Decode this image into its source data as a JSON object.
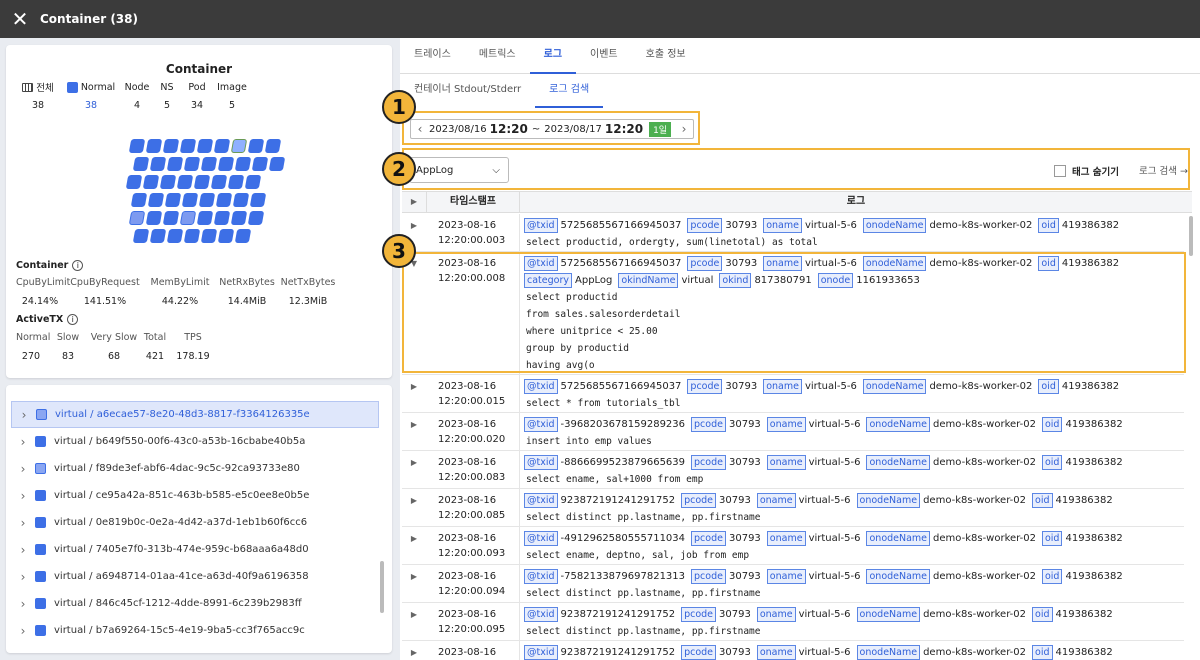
{
  "header": {
    "title": "Container (38)"
  },
  "summary": {
    "total_label": "전체",
    "total_value": "38",
    "normal_label": "Normal",
    "normal_value": "38",
    "node_label": "Node",
    "node_value": "4",
    "ns_label": "NS",
    "ns_value": "5",
    "pod_label": "Pod",
    "pod_value": "34",
    "image_label": "Image",
    "image_value": "5"
  },
  "panel_title": "Container",
  "container_metrics": {
    "title": "Container",
    "labels": [
      "CpuByLimit",
      "CpuByRequest",
      "MemByLimit",
      "NetRxBytes",
      "NetTxBytes"
    ],
    "values": [
      "24.14%",
      "141.51%",
      "44.22%",
      "14.4MiB",
      "12.3MiB"
    ]
  },
  "activetx": {
    "title": "ActiveTX",
    "labels": [
      "Normal",
      "Slow",
      "Very Slow",
      "Total",
      "TPS"
    ],
    "values": [
      "270",
      "83",
      "68",
      "421",
      "178.19"
    ]
  },
  "containers": [
    "virtual / a6ecae57-8e20-48d3-8817-f3364126335e",
    "virtual / b649f550-00f6-43c0-a53b-16cbabe40b5a",
    "virtual / f89de3ef-abf6-4dac-9c5c-92ca93733e80",
    "virtual / ce95a42a-851c-463b-b585-e5c0ee8e0b5e",
    "virtual / 0e819b0c-0e2a-4d42-a37d-1eb1b60f6cc6",
    "virtual / 7405e7f0-313b-474e-959c-b68aaa6a48d0",
    "virtual / a6948714-01aa-41ce-a63d-40f9a6196358",
    "virtual / 846c45cf-1212-4dde-8991-6c239b2983ff",
    "virtual / b7a69264-15c5-4e19-9ba5-cc3f765acc9c"
  ],
  "tabs": [
    "트레이스",
    "메트릭스",
    "로그",
    "이벤트",
    "호출 정보"
  ],
  "subtabs": [
    "컨테이너 Stdout/Stderr",
    "로그 검색"
  ],
  "date": {
    "from_date": "2023/08/16",
    "from_time": "12:20",
    "sep": "~",
    "to_date": "2023/08/17",
    "to_time": "12:20",
    "range": "1일"
  },
  "filter": {
    "category": "AppLog",
    "hide_tags": "태그 숨기기",
    "search": "로그 검색 →"
  },
  "markers": [
    "1",
    "2",
    "3"
  ],
  "table": {
    "col_time": "타임스탬프",
    "col_log": "로그"
  },
  "rows": [
    {
      "date": "2023-08-16",
      "time": "12:20:00.003",
      "txid": "5725685567166945037",
      "pcode": "30793",
      "oname": "virtual-5-6",
      "onode": "demo-k8s-worker-02",
      "oid": "419386382",
      "lines": [
        "select productid, ordergty, sum(linetotal) as total"
      ]
    },
    {
      "date": "2023-08-16",
      "time": "12:20:00.008",
      "txid": "5725685567166945037",
      "pcode": "30793",
      "oname": "virtual-5-6",
      "onode": "demo-k8s-worker-02",
      "oid": "419386382",
      "category": "AppLog",
      "okindName": "virtual",
      "okind": "817380791",
      "onode_id": "1161933653",
      "lines": [
        "select productid",
        "from sales.salesorderdetail",
        "where unitprice < 25.00",
        "group by productid",
        "having avg(o"
      ]
    },
    {
      "date": "2023-08-16",
      "time": "12:20:00.015",
      "txid": "5725685567166945037",
      "pcode": "30793",
      "oname": "virtual-5-6",
      "onode": "demo-k8s-worker-02",
      "oid": "419386382",
      "lines": [
        "select * from tutorials_tbl"
      ]
    },
    {
      "date": "2023-08-16",
      "time": "12:20:00.020",
      "txid": "-3968203678159289236",
      "pcode": "30793",
      "oname": "virtual-5-6",
      "onode": "demo-k8s-worker-02",
      "oid": "419386382",
      "lines": [
        "insert into emp values"
      ]
    },
    {
      "date": "2023-08-16",
      "time": "12:20:00.083",
      "txid": "-8866699523879665639",
      "pcode": "30793",
      "oname": "virtual-5-6",
      "onode": "demo-k8s-worker-02",
      "oid": "419386382",
      "lines": [
        "select ename, sal+1000 from emp"
      ]
    },
    {
      "date": "2023-08-16",
      "time": "12:20:00.085",
      "txid": "923872191241291752",
      "pcode": "30793",
      "oname": "virtual-5-6",
      "onode": "demo-k8s-worker-02",
      "oid": "419386382",
      "lines": [
        "select distinct pp.lastname, pp.firstname"
      ]
    },
    {
      "date": "2023-08-16",
      "time": "12:20:00.093",
      "txid": "-4912962580555711034",
      "pcode": "30793",
      "oname": "virtual-5-6",
      "onode": "demo-k8s-worker-02",
      "oid": "419386382",
      "lines": [
        "select ename, deptno, sal, job from emp"
      ]
    },
    {
      "date": "2023-08-16",
      "time": "12:20:00.094",
      "txid": "-7582133879697821313",
      "pcode": "30793",
      "oname": "virtual-5-6",
      "onode": "demo-k8s-worker-02",
      "oid": "419386382",
      "lines": [
        "select distinct pp.lastname, pp.firstname"
      ]
    },
    {
      "date": "2023-08-16",
      "time": "12:20:00.095",
      "txid": "923872191241291752",
      "pcode": "30793",
      "oname": "virtual-5-6",
      "onode": "demo-k8s-worker-02",
      "oid": "419386382",
      "lines": [
        "select distinct pp.lastname, pp.firstname"
      ]
    },
    {
      "date": "2023-08-16",
      "time": "",
      "txid": "923872191241291752",
      "pcode": "30793",
      "oname": "virtual-5-6",
      "onode": "demo-k8s-worker-02",
      "oid": "419386382",
      "lines": []
    }
  ],
  "tag_names": {
    "txid": "@txid",
    "pcode": "pcode",
    "oname": "oname",
    "onodeName": "onodeName",
    "oid": "oid",
    "category": "category",
    "okindName": "okindName",
    "okind": "okind",
    "onode": "onode"
  }
}
